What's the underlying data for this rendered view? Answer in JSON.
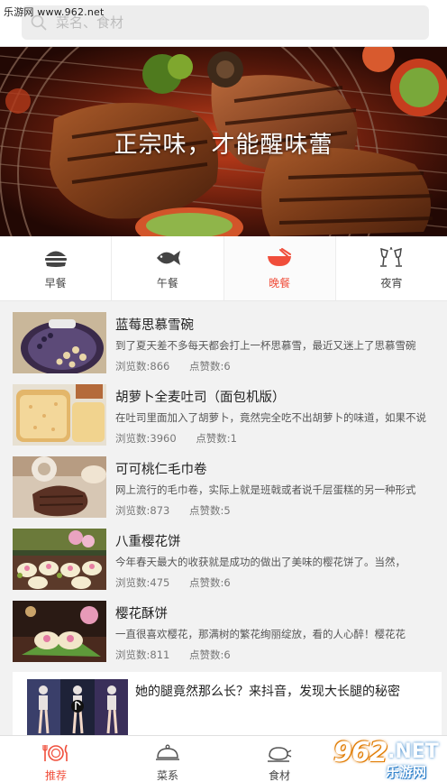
{
  "watermark": {
    "top_left": "乐游网 www.962.net",
    "bottom_right_num": "962",
    "bottom_right_domain": ".NET",
    "bottom_right_sub": "乐游网"
  },
  "search": {
    "placeholder": "菜名、食材",
    "icon": "search-icon"
  },
  "banner": {
    "slogan": "正宗味，才能醒味蕾"
  },
  "tabs": [
    {
      "label": "早餐",
      "icon": "burger-icon",
      "active": false
    },
    {
      "label": "午餐",
      "icon": "fish-icon",
      "active": false
    },
    {
      "label": "晚餐",
      "icon": "hotpot-icon",
      "active": true
    },
    {
      "label": "夜宵",
      "icon": "wine-glasses-icon",
      "active": false
    }
  ],
  "recipes": [
    {
      "title": "蓝莓思慕雪碗",
      "desc": "到了夏天差不多每天都会打上一杯思慕雪，最近又迷上了思慕雪碗",
      "views": "浏览数:866",
      "likes": "点赞数:6"
    },
    {
      "title": "胡萝卜全麦吐司（面包机版）",
      "desc": "在吐司里面加入了胡萝卜，竟然完全吃不出胡萝卜的味道，如果不说",
      "views": "浏览数:3960",
      "likes": "点赞数:1"
    },
    {
      "title": "可可桃仁毛巾卷",
      "desc": "网上流行的毛巾卷，实际上就是班戟或者说千层蛋糕的另一种形式",
      "views": "浏览数:873",
      "likes": "点赞数:5"
    },
    {
      "title": "八重樱花饼",
      "desc": "今年春天最大的收获就是成功的做出了美味的樱花饼了。当然，",
      "views": "浏览数:475",
      "likes": "点赞数:6"
    },
    {
      "title": "樱花酥饼",
      "desc": "一直很喜欢樱花，那满树的繁花绚丽绽放，看的人心醉！樱花花",
      "views": "浏览数:811",
      "likes": "点赞数:6"
    }
  ],
  "ad": {
    "title": "她的腿竟然那么长？来抖音，发现大长腿的秘密"
  },
  "bottom_nav": [
    {
      "label": "推荐",
      "icon": "plate-cutlery-icon",
      "active": true
    },
    {
      "label": "菜系",
      "icon": "cloche-icon",
      "active": false
    },
    {
      "label": "食材",
      "icon": "chicken-icon",
      "active": false
    },
    {
      "label": "",
      "icon": "",
      "active": false
    }
  ],
  "colors": {
    "accent": "#f04e3b",
    "background": "#f2f2f2"
  }
}
